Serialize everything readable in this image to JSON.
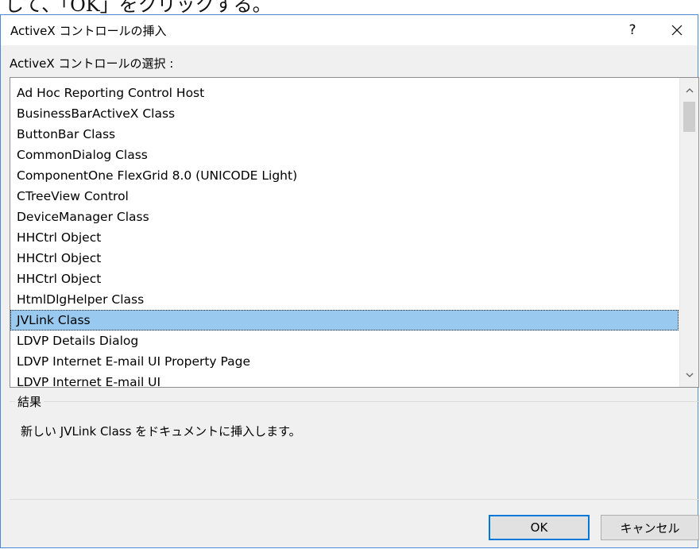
{
  "top_strip": {
    "text": "して、「OK」をクリックする。"
  },
  "dialog": {
    "title": "ActiveX コントロールの挿入",
    "help_label": "?",
    "select_label": "ActiveX コントロールの選択 :",
    "items": [
      {
        "label": "Ad Hoc Reporting Control Host"
      },
      {
        "label": "BusinessBarActiveX Class"
      },
      {
        "label": "ButtonBar Class"
      },
      {
        "label": "CommonDialog Class"
      },
      {
        "label": "ComponentOne FlexGrid 8.0 (UNICODE Light)"
      },
      {
        "label": "CTreeView Control"
      },
      {
        "label": "DeviceManager Class"
      },
      {
        "label": "HHCtrl Object"
      },
      {
        "label": "HHCtrl Object"
      },
      {
        "label": "HHCtrl Object"
      },
      {
        "label": "HtmlDlgHelper Class"
      },
      {
        "label": "JVLink Class"
      },
      {
        "label": "LDVP Details Dialog"
      },
      {
        "label": "LDVP Internet E-mail UI Property Page"
      },
      {
        "label": "LDVP Internet E-mail UI"
      }
    ],
    "selected_item": "JVLink Class",
    "result_label": "結果",
    "result_text": "新しい JVLink Class をドキュメントに挿入します。",
    "ok_label": "OK",
    "cancel_label": "キャンセル"
  },
  "colors": {
    "selection": "#99c9ef",
    "window_border": "#4a89d4",
    "default_button_border": "#0078d7",
    "dialog_background": "#f0f0f0"
  }
}
